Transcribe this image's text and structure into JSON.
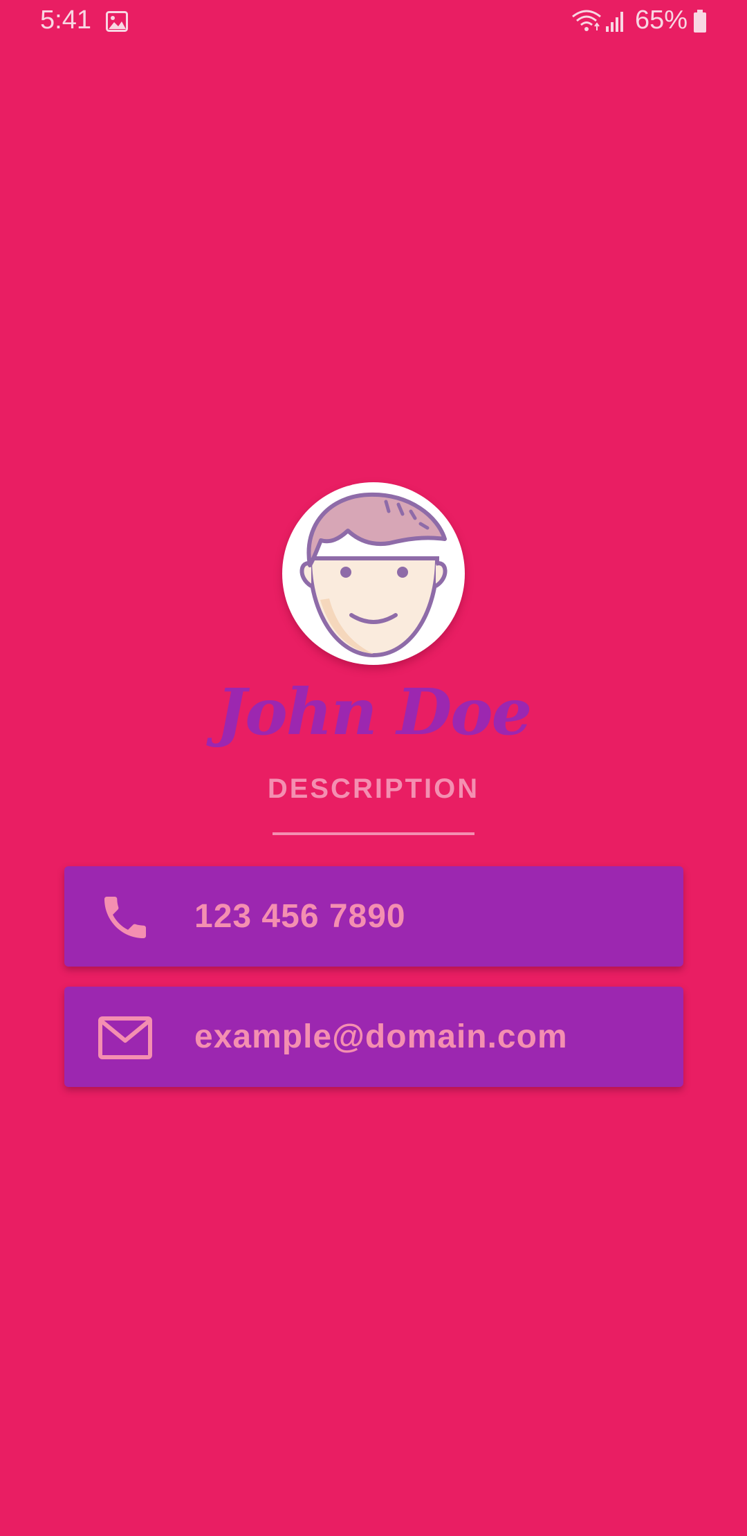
{
  "status_bar": {
    "time": "5:41",
    "battery": "65%",
    "icons": [
      "gallery-icon",
      "wifi-icon",
      "signal-icon",
      "battery-icon"
    ]
  },
  "profile": {
    "name": "John Doe",
    "description": "DESCRIPTION",
    "avatar_icon": "boy-face-avatar"
  },
  "contacts": {
    "phone": {
      "icon": "phone-icon",
      "value": "123 456 7890"
    },
    "email": {
      "icon": "envelope-icon",
      "value": "example@domain.com"
    }
  },
  "colors": {
    "background": "#E91E63",
    "card": "#9C27B0",
    "accent_text": "#F48FB1",
    "name_text": "#9C27B0"
  }
}
